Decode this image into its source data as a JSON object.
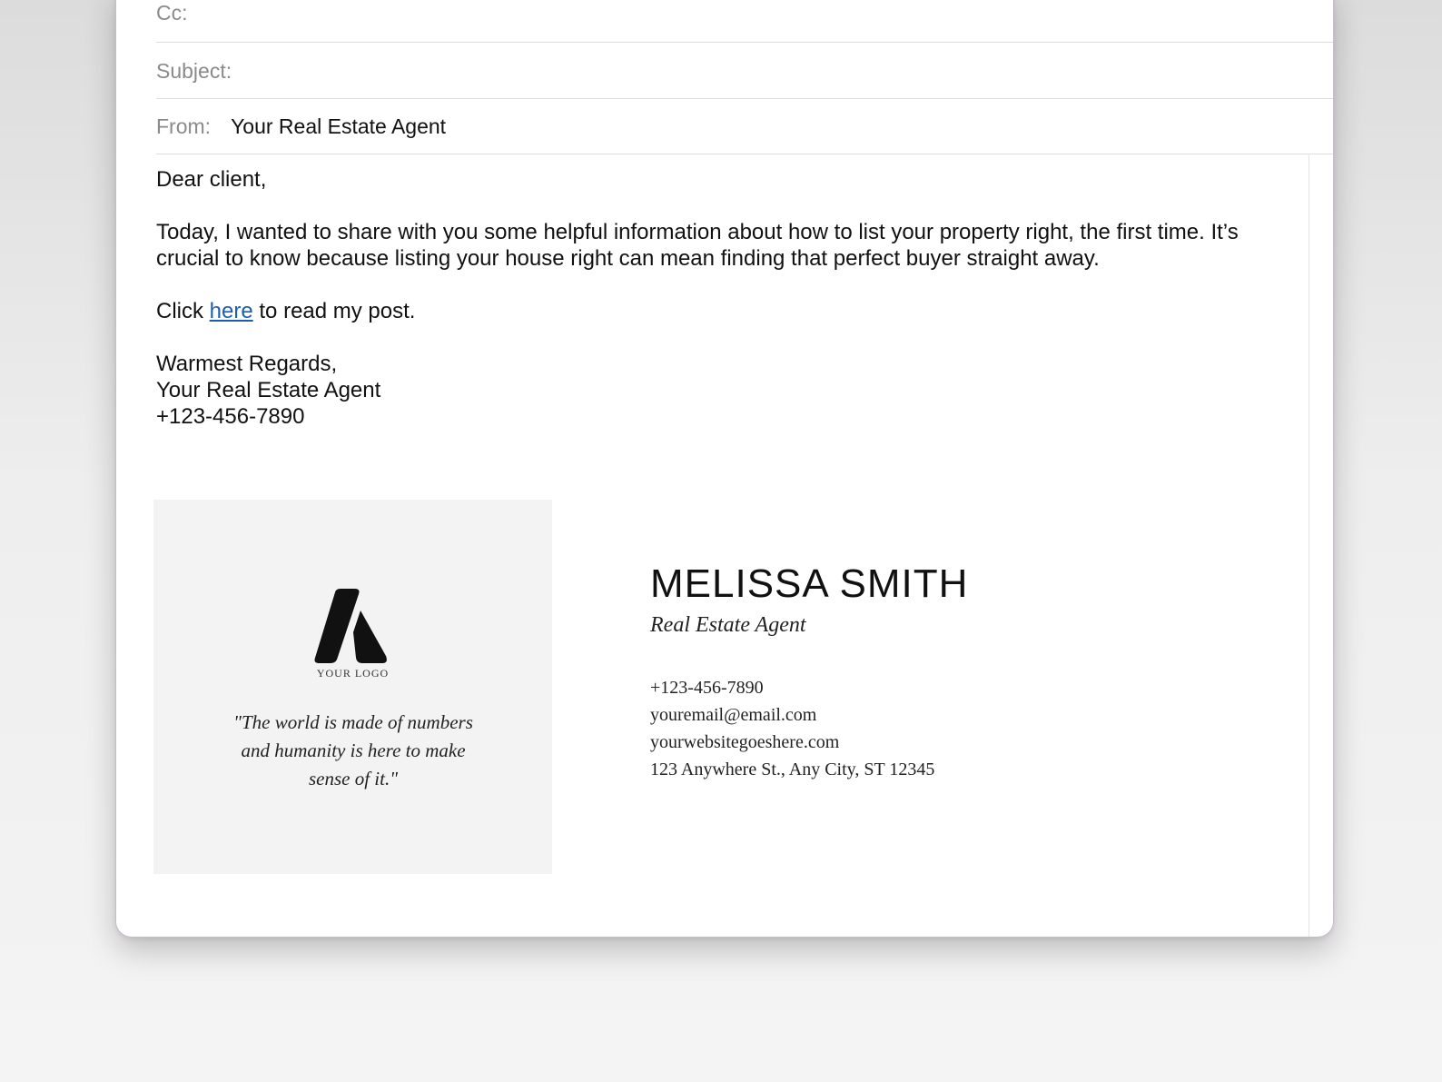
{
  "header": {
    "cc_label": "Cc:",
    "subject_label": "Subject:",
    "from_label": "From:",
    "from_value": "Your Real Estate Agent"
  },
  "body": {
    "greeting": "Dear client,",
    "paragraph": "Today, I wanted to share with you some helpful information about how to list your property right, the first time.  It’s crucial to know because listing your house right can mean finding that perfect buyer straight away.",
    "click_prefix": "Click ",
    "click_link": "here",
    "click_suffix": " to read my post.",
    "closing": "Warmest Regards,",
    "sender_name": "Your Real Estate Agent",
    "sender_phone": "+123-456-7890"
  },
  "signature": {
    "logo_text": "YOUR LOGO",
    "quote_line1": "\"The world is made of numbers",
    "quote_line2": "and humanity is here to make",
    "quote_line3": "sense of it.\"",
    "name": "MELISSA SMITH",
    "title": "Real Estate Agent",
    "phone": "+123-456-7890",
    "email": "youremail@email.com",
    "website": "yourwebsitegoeshere.com",
    "address": "123 Anywhere St., Any City, ST 12345"
  },
  "colors": {
    "link": "#1a5fb4",
    "signature_panel": "#f3f3f3"
  }
}
